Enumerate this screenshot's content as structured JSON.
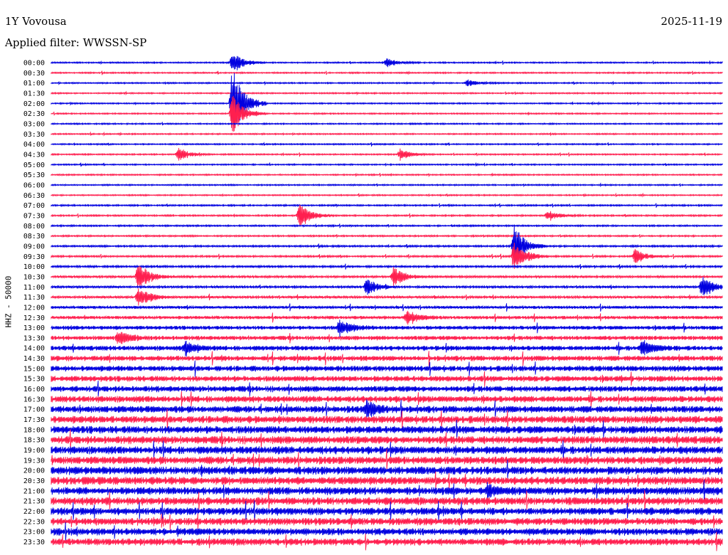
{
  "header": {
    "station": "1Y Vovousa",
    "date": "2025-11-19",
    "filter": "Applied filter: WWSSN-SP"
  },
  "chart_data": {
    "type": "line",
    "kind": "helicorder",
    "ylabel": "HHZ - 50000",
    "row_labels": [
      "00:00",
      "00:30",
      "01:00",
      "01:30",
      "02:00",
      "02:30",
      "03:00",
      "03:30",
      "04:00",
      "04:30",
      "05:00",
      "05:30",
      "06:00",
      "06:30",
      "07:00",
      "07:30",
      "08:00",
      "08:30",
      "09:00",
      "09:30",
      "10:00",
      "10:30",
      "11:00",
      "11:30",
      "12:00",
      "12:30",
      "13:00",
      "13:30",
      "14:00",
      "14:30",
      "15:00",
      "15:30",
      "16:00",
      "16:30",
      "17:00",
      "17:30",
      "18:00",
      "18:30",
      "19:00",
      "19:30",
      "20:00",
      "20:30",
      "21:00",
      "21:30",
      "22:00",
      "22:30",
      "23:00",
      "23:30"
    ],
    "colors": [
      "#0000e0",
      "#ff1f4f"
    ],
    "grid": false,
    "noise_level": [
      0.6,
      0.6,
      0.6,
      0.6,
      0.6,
      0.6,
      0.6,
      0.6,
      0.6,
      0.6,
      0.6,
      0.6,
      0.6,
      0.6,
      0.7,
      0.7,
      0.7,
      0.7,
      0.8,
      0.8,
      0.9,
      1.0,
      1.0,
      1.1,
      1.3,
      1.5,
      1.8,
      2.0,
      2.2,
      2.4,
      2.5,
      2.6,
      2.7,
      2.9,
      3.1,
      3.3,
      3.4,
      3.5,
      3.5,
      3.5,
      3.6,
      3.6,
      3.5,
      3.5,
      3.4,
      3.3,
      3.2,
      3.2
    ],
    "events": [
      {
        "row": 0,
        "pos": 0.27,
        "amp": 14
      },
      {
        "row": 0,
        "pos": 0.5,
        "amp": 6
      },
      {
        "row": 2,
        "pos": 0.62,
        "amp": 5
      },
      {
        "row": 4,
        "pos": 0.27,
        "amp": 55
      },
      {
        "row": 5,
        "pos": 0.27,
        "amp": 30
      },
      {
        "row": 9,
        "pos": 0.19,
        "amp": 10
      },
      {
        "row": 9,
        "pos": 0.52,
        "amp": 8
      },
      {
        "row": 15,
        "pos": 0.37,
        "amp": 18
      },
      {
        "row": 15,
        "pos": 0.74,
        "amp": 7
      },
      {
        "row": 18,
        "pos": 0.69,
        "amp": 30
      },
      {
        "row": 19,
        "pos": 0.69,
        "amp": 25
      },
      {
        "row": 19,
        "pos": 0.87,
        "amp": 10
      },
      {
        "row": 21,
        "pos": 0.13,
        "amp": 20
      },
      {
        "row": 21,
        "pos": 0.51,
        "amp": 14
      },
      {
        "row": 22,
        "pos": 0.47,
        "amp": 12
      },
      {
        "row": 22,
        "pos": 0.97,
        "amp": 16
      },
      {
        "row": 23,
        "pos": 0.13,
        "amp": 14
      },
      {
        "row": 25,
        "pos": 0.53,
        "amp": 10
      },
      {
        "row": 26,
        "pos": 0.43,
        "amp": 12
      },
      {
        "row": 27,
        "pos": 0.1,
        "amp": 10
      },
      {
        "row": 28,
        "pos": 0.2,
        "amp": 9
      },
      {
        "row": 28,
        "pos": 0.88,
        "amp": 10
      },
      {
        "row": 34,
        "pos": 0.47,
        "amp": 10
      },
      {
        "row": 42,
        "pos": 0.65,
        "amp": 9
      }
    ]
  }
}
